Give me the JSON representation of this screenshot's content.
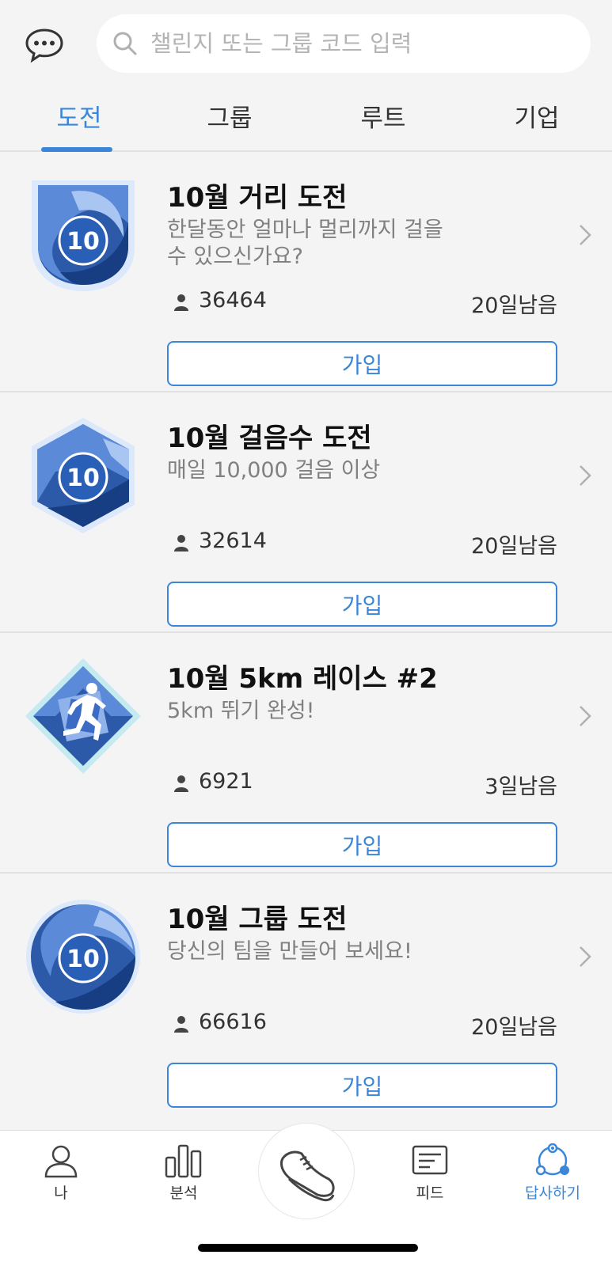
{
  "search": {
    "placeholder": "챌린지 또는 그룹 코드 입력"
  },
  "tabs": [
    {
      "label": "도전",
      "active": true
    },
    {
      "label": "그룹",
      "active": false
    },
    {
      "label": "루트",
      "active": false
    },
    {
      "label": "기업",
      "active": false
    }
  ],
  "challenges": [
    {
      "title": "10월 거리 도전",
      "description": "한달동안 얼마나 멀리까지 걸을 수 있으신가요?",
      "participants": "36464",
      "remaining": "20일남음",
      "join_label": "가입",
      "badge_number": "10",
      "badge_icon": "shield-badge-icon"
    },
    {
      "title": "10월 걸음수 도전",
      "description": "매일  10,000 걸음 이상",
      "participants": "32614",
      "remaining": "20일남음",
      "join_label": "가입",
      "badge_number": "10",
      "badge_icon": "hexagon-badge-icon"
    },
    {
      "title": "10월 5km 레이스 #2",
      "description": "5km 뛰기 완성!",
      "participants": "6921",
      "remaining": "3일남음",
      "join_label": "가입",
      "badge_icon": "runner-diamond-badge-icon"
    },
    {
      "title": "10월 그룹 도전",
      "description": "당신의 팀을 만들어 보세요!",
      "participants": "66616",
      "remaining": "20일남음",
      "join_label": "가입",
      "badge_number": "10",
      "badge_icon": "circle-badge-icon"
    }
  ],
  "bottom_nav": [
    {
      "label": "나",
      "icon": "person-icon",
      "active": false
    },
    {
      "label": "분석",
      "icon": "bar-chart-icon",
      "active": false
    },
    {
      "label": "",
      "icon": "shoe-icon",
      "active": false
    },
    {
      "label": "피드",
      "icon": "feed-icon",
      "active": false
    },
    {
      "label": "답사하기",
      "icon": "explore-icon",
      "active": true
    }
  ],
  "colors": {
    "accent": "#3b86d8",
    "background": "#f4f4f4",
    "badge_blue": "#2c5aa8"
  }
}
